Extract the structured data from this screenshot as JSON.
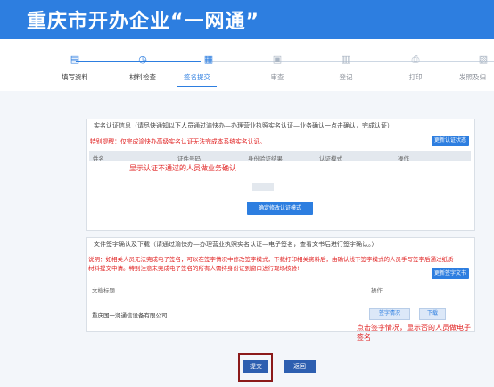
{
  "header": {
    "title": "重庆市开办企业“一网通”"
  },
  "steps": [
    {
      "label": "填写资料",
      "icon": "edit-doc-icon",
      "state": "done"
    },
    {
      "label": "材料检查",
      "icon": "check-clock-icon",
      "state": "done"
    },
    {
      "label": "签名提交",
      "icon": "sign-doc-icon",
      "state": "active"
    },
    {
      "label": "审查",
      "icon": "review-icon",
      "state": "pending"
    },
    {
      "label": "登记",
      "icon": "register-icon",
      "state": "pending"
    },
    {
      "label": "打印",
      "icon": "printer-icon",
      "state": "pending"
    },
    {
      "label": "发照及归",
      "icon": "license-icon",
      "state": "pending"
    }
  ],
  "realname": {
    "title": "实名认证信息（请尽快通知以下人员通过渝快办—办理营业执照实名认证—业务确认一点击确认，完成认证）",
    "warning": "特别提醒：仅完成渝快办高级实名认证无法完成本系统实名认证。",
    "refresh_button": "更新认证状态",
    "columns": [
      "姓名",
      "证件号码",
      "身份验证结果",
      "认证模式",
      "操作"
    ],
    "confirm_button": "确定修改认证模式"
  },
  "docsign": {
    "title": "文件签字确认及下载（请通过渝快办—办理营业执照实名认证—电子签名，查看文书后进行签字确认。）",
    "notice": "说明：如相关人员无法完成电子签名，可以在签字情况中修改签字模式，下载打印相关资料后，由确认线下签字模式的人员手写签字后通过纸质材料提交申请。特别注意未完成电子签名的所有人需持身份证到窗口进行现场核验!",
    "update_button": "更新签字文书",
    "columns": [
      "文档标题",
      "操作"
    ],
    "rows": [
      {
        "title": "重庆国一润通信设备有限公司",
        "sign_button": "签字情况",
        "download_button": "下载"
      }
    ]
  },
  "annotations": {
    "note1": "显示认证不通过的人员做业务确认",
    "note2": "点击签字情况，显示否的人员做电子签名"
  },
  "actions": {
    "submit": "提交",
    "back": "返回"
  },
  "colors": {
    "brand": "#2d7ee0",
    "warning": "#e02020",
    "submit": "#2d5fb0",
    "highlight_box": "#8b1a1a"
  }
}
